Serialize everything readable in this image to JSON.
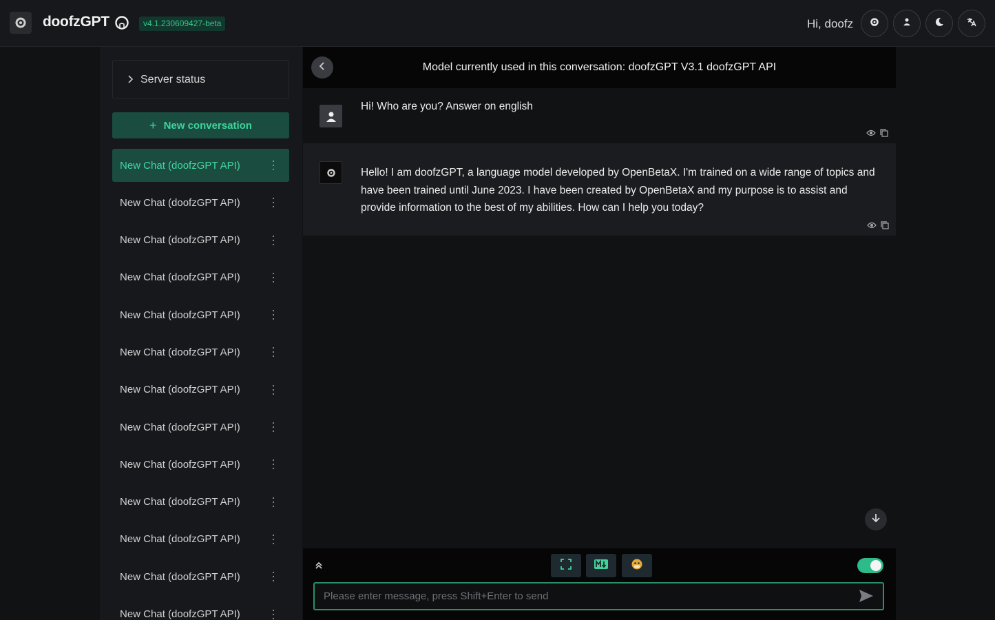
{
  "header": {
    "app_title": "doofzGPT",
    "version": "v4.1.230609427-beta",
    "greeting": "Hi, doofz",
    "icons": [
      "settings-icon",
      "users-icon",
      "moon-icon",
      "translate-icon"
    ]
  },
  "sidebar": {
    "server_status": "Server status",
    "new_conversation": "New conversation",
    "chats": [
      "New Chat (doofzGPT API)",
      "New Chat (doofzGPT API)",
      "New Chat (doofzGPT API)",
      "New Chat (doofzGPT API)",
      "New Chat (doofzGPT API)",
      "New Chat (doofzGPT API)",
      "New Chat (doofzGPT API)",
      "New Chat (doofzGPT API)",
      "New Chat (doofzGPT API)",
      "New Chat (doofzGPT API)",
      "New Chat (doofzGPT API)",
      "New Chat (doofzGPT API)",
      "New Chat (doofzGPT API)"
    ],
    "active_index": 0
  },
  "main": {
    "model_info": "Model currently used in this conversation: doofzGPT V3.1 doofzGPT API",
    "messages": [
      {
        "role": "user",
        "text": "Hi! Who are you? Answer on english"
      },
      {
        "role": "assistant",
        "text": "Hello! I am doofzGPT, a language model developed by OpenBetaX. I'm trained on a wide range of topics and have been trained until June 2023. I have been created by OpenBetaX and my purpose is to assist and provide information to the best of my abilities. How can I help you today?"
      }
    ]
  },
  "composer": {
    "placeholder": "Please enter message, press Shift+Enter to send",
    "toggle_on": true
  },
  "colors": {
    "accent": "#2dbb8a",
    "accent_dark": "#1a4d40",
    "background": "#111214"
  }
}
